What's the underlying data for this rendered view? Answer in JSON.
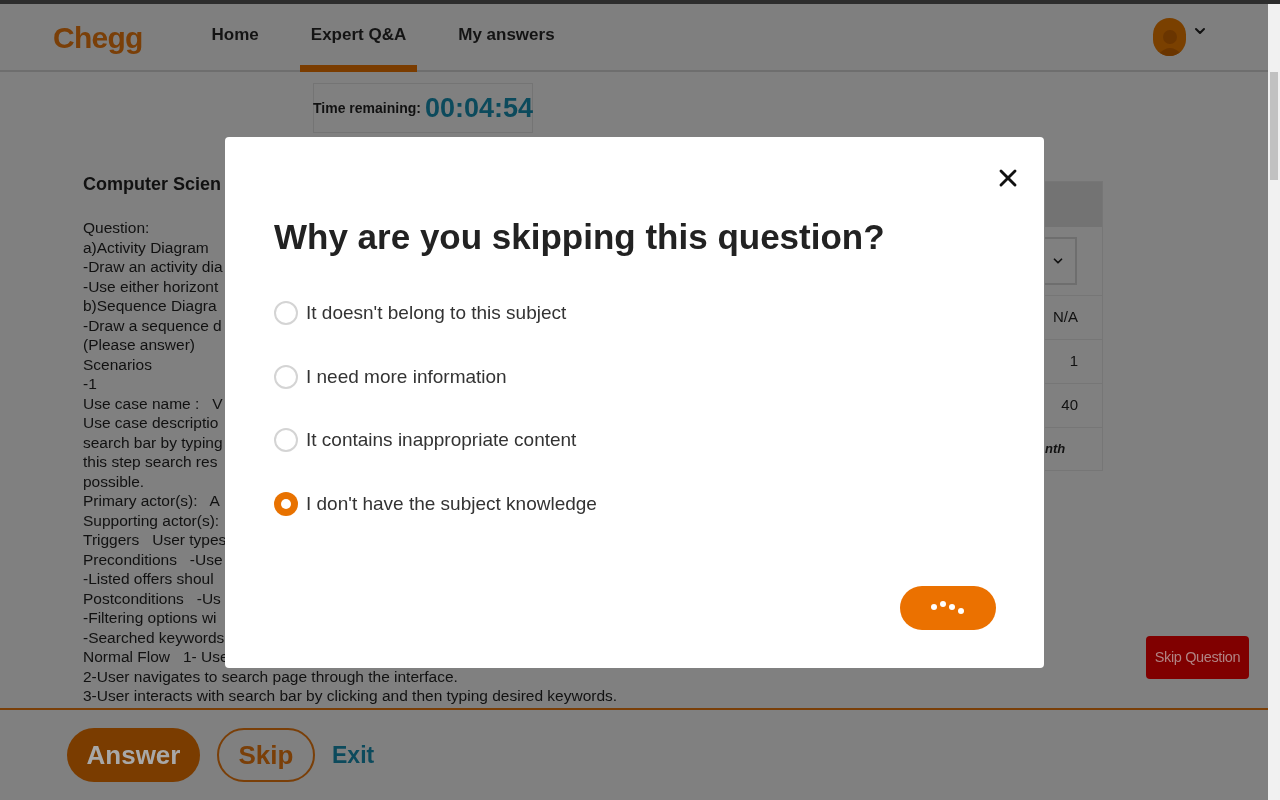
{
  "header": {
    "logo": "Chegg",
    "nav": [
      {
        "label": "Home",
        "selected": false
      },
      {
        "label": "Expert Q&A",
        "selected": true
      },
      {
        "label": "My answers",
        "selected": false
      }
    ]
  },
  "timer": {
    "label": "Time remaining:",
    "value": "00:04:54"
  },
  "question": {
    "title": "Computer Scien",
    "lines": [
      "Question:",
      "a)Activity Diagram",
      "-Draw an activity dia",
      "-Use either horizont",
      "b)Sequence Diagra",
      "-Draw a sequence d",
      "(Please answer)",
      "Scenarios",
      "-1",
      "Use case name :   V",
      "Use case descriptio",
      "search bar by typing",
      "this step search res",
      "possible.",
      "Primary actor(s):   A",
      "Supporting actor(s):",
      "Triggers   User types",
      "Preconditions   -Use",
      "-Listed offers shoul",
      "Postconditions   -Us",
      "-Filtering options wi",
      "-Searched keywords",
      "Normal Flow   1- Use",
      "2-User navigates to search page through the interface.",
      "3-User interacts with search bar by clicking and then typing desired keywords."
    ]
  },
  "side_table": {
    "cells": [
      "N/A",
      "1",
      "40"
    ],
    "footer": "nth"
  },
  "modal": {
    "title": "Why are you skipping this question?",
    "options": [
      {
        "label": "It doesn't belong to this subject",
        "selected": false
      },
      {
        "label": "I need more information",
        "selected": false
      },
      {
        "label": "It contains inappropriate content",
        "selected": false
      },
      {
        "label": "I don't have the subject knowledge",
        "selected": true
      }
    ]
  },
  "skip_question_button": "Skip Question",
  "footer": {
    "answer": "Answer",
    "skip": "Skip",
    "exit": "Exit"
  }
}
